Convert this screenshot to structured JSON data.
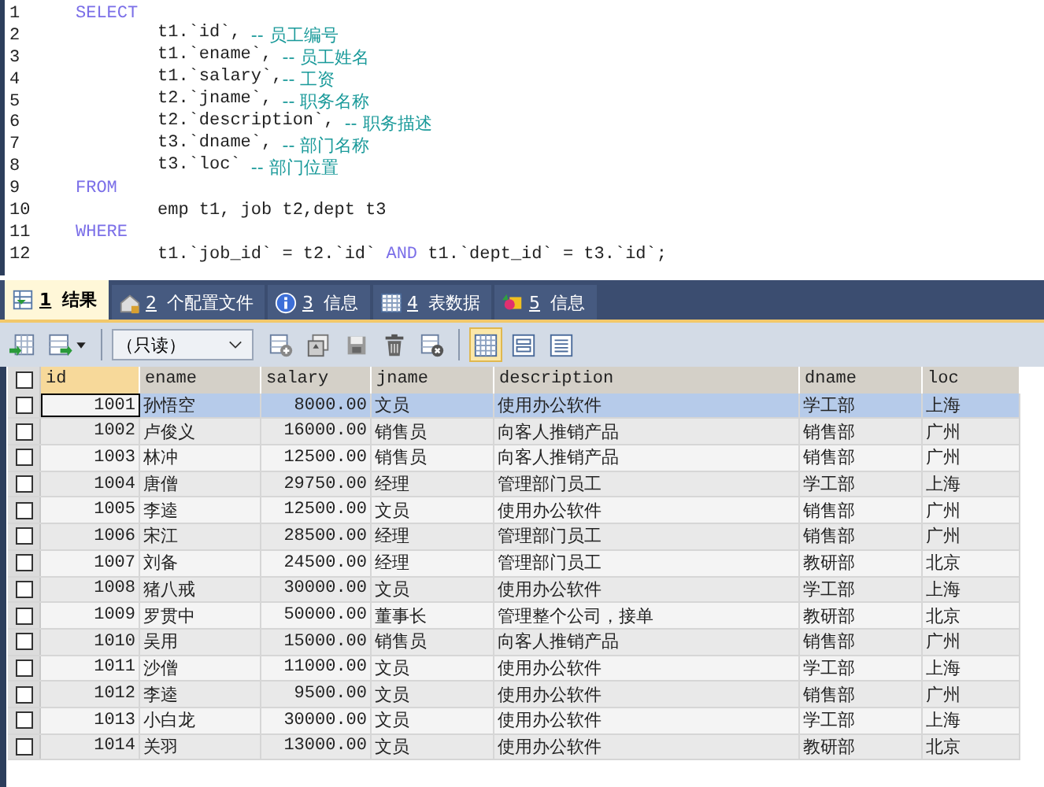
{
  "editor": {
    "lines": [
      {
        "number": "1",
        "segments": [
          {
            "kind": "keyword",
            "text": "SELECT"
          }
        ]
      },
      {
        "number": "2",
        "segments": [
          {
            "kind": "indent"
          },
          {
            "kind": "plain",
            "text": "t1.`id`, "
          },
          {
            "kind": "comment",
            "text": "-- 员工编号"
          }
        ]
      },
      {
        "number": "3",
        "segments": [
          {
            "kind": "indent"
          },
          {
            "kind": "plain",
            "text": "t1.`ename`, "
          },
          {
            "kind": "comment",
            "text": "-- 员工姓名"
          }
        ]
      },
      {
        "number": "4",
        "segments": [
          {
            "kind": "indent"
          },
          {
            "kind": "plain",
            "text": "t1.`salary`,"
          },
          {
            "kind": "comment",
            "text": "-- 工资"
          }
        ]
      },
      {
        "number": "5",
        "segments": [
          {
            "kind": "indent"
          },
          {
            "kind": "plain",
            "text": "t2.`jname`, "
          },
          {
            "kind": "comment",
            "text": "-- 职务名称"
          }
        ]
      },
      {
        "number": "6",
        "segments": [
          {
            "kind": "indent"
          },
          {
            "kind": "plain",
            "text": "t2.`description`, "
          },
          {
            "kind": "comment",
            "text": "-- 职务描述"
          }
        ]
      },
      {
        "number": "7",
        "segments": [
          {
            "kind": "indent"
          },
          {
            "kind": "plain",
            "text": "t3.`dname`, "
          },
          {
            "kind": "comment",
            "text": "-- 部门名称"
          }
        ]
      },
      {
        "number": "8",
        "segments": [
          {
            "kind": "indent"
          },
          {
            "kind": "plain",
            "text": "t3.`loc` "
          },
          {
            "kind": "comment",
            "text": "-- 部门位置"
          }
        ]
      },
      {
        "number": "9",
        "segments": [
          {
            "kind": "keyword",
            "text": "FROM"
          }
        ]
      },
      {
        "number": "10",
        "segments": [
          {
            "kind": "indent"
          },
          {
            "kind": "plain",
            "text": "emp t1, job t2,dept t3"
          }
        ]
      },
      {
        "number": "11",
        "segments": [
          {
            "kind": "keyword",
            "text": "WHERE"
          }
        ]
      },
      {
        "number": "12",
        "segments": [
          {
            "kind": "indent"
          },
          {
            "kind": "plain",
            "text": "t1.`job_id` = t2.`id` "
          },
          {
            "kind": "keyword",
            "text": "AND"
          },
          {
            "kind": "plain",
            "text": " t1.`dept_id` = t3.`id`;"
          }
        ]
      }
    ]
  },
  "tabs": [
    {
      "key": "1",
      "label": "结果",
      "selected": true
    },
    {
      "key": "2",
      "label": "个配置文件",
      "selected": false
    },
    {
      "key": "3",
      "label": "信息",
      "selected": false
    },
    {
      "key": "4",
      "label": "表数据",
      "selected": false
    },
    {
      "key": "5",
      "label": "信息",
      "selected": false
    }
  ],
  "toolbar": {
    "mode_select": {
      "value": "（只读）"
    },
    "views": [
      {
        "selected": true
      },
      {
        "selected": false
      },
      {
        "selected": false
      }
    ]
  },
  "table": {
    "all_checked": false,
    "columns": [
      "id",
      "ename",
      "salary",
      "jname",
      "description",
      "dname",
      "loc"
    ],
    "rows": [
      {
        "selected": true,
        "checked": false,
        "cells": [
          "1001",
          "孙悟空",
          "8000.00",
          "文员",
          "使用办公软件",
          "学工部",
          "上海"
        ]
      },
      {
        "selected": false,
        "checked": false,
        "cells": [
          "1002",
          "卢俊义",
          "16000.00",
          "销售员",
          "向客人推销产品",
          "销售部",
          "广州"
        ]
      },
      {
        "selected": false,
        "checked": false,
        "cells": [
          "1003",
          "林冲",
          "12500.00",
          "销售员",
          "向客人推销产品",
          "销售部",
          "广州"
        ]
      },
      {
        "selected": false,
        "checked": false,
        "cells": [
          "1004",
          "唐僧",
          "29750.00",
          "经理",
          "管理部门员工",
          "学工部",
          "上海"
        ]
      },
      {
        "selected": false,
        "checked": false,
        "cells": [
          "1005",
          "李逵",
          "12500.00",
          "文员",
          "使用办公软件",
          "销售部",
          "广州"
        ]
      },
      {
        "selected": false,
        "checked": false,
        "cells": [
          "1006",
          "宋江",
          "28500.00",
          "经理",
          "管理部门员工",
          "销售部",
          "广州"
        ]
      },
      {
        "selected": false,
        "checked": false,
        "cells": [
          "1007",
          "刘备",
          "24500.00",
          "经理",
          "管理部门员工",
          "教研部",
          "北京"
        ]
      },
      {
        "selected": false,
        "checked": false,
        "cells": [
          "1008",
          "猪八戒",
          "30000.00",
          "文员",
          "使用办公软件",
          "学工部",
          "上海"
        ]
      },
      {
        "selected": false,
        "checked": false,
        "cells": [
          "1009",
          "罗贯中",
          "50000.00",
          "董事长",
          "管理整个公司，接单",
          "教研部",
          "北京"
        ]
      },
      {
        "selected": false,
        "checked": false,
        "cells": [
          "1010",
          "吴用",
          "15000.00",
          "销售员",
          "向客人推销产品",
          "销售部",
          "广州"
        ]
      },
      {
        "selected": false,
        "checked": false,
        "cells": [
          "1011",
          "沙僧",
          "11000.00",
          "文员",
          "使用办公软件",
          "学工部",
          "上海"
        ]
      },
      {
        "selected": false,
        "checked": false,
        "cells": [
          "1012",
          "李逵",
          "9500.00",
          "文员",
          "使用办公软件",
          "销售部",
          "广州"
        ]
      },
      {
        "selected": false,
        "checked": false,
        "cells": [
          "1013",
          "小白龙",
          "30000.00",
          "文员",
          "使用办公软件",
          "学工部",
          "上海"
        ]
      },
      {
        "selected": false,
        "checked": false,
        "cells": [
          "1014",
          "关羽",
          "13000.00",
          "文员",
          "使用办公软件",
          "教研部",
          "北京"
        ]
      }
    ]
  }
}
